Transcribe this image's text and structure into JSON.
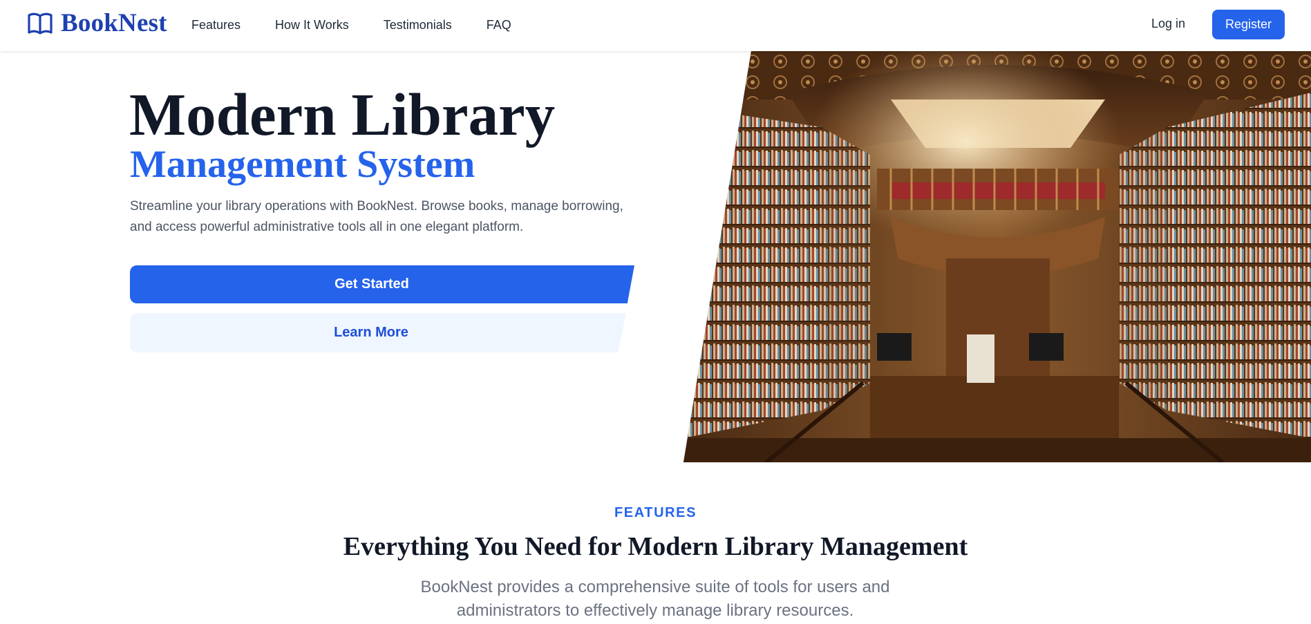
{
  "header": {
    "brand": "BookNest",
    "nav": [
      {
        "label": "Features"
      },
      {
        "label": "How It Works"
      },
      {
        "label": "Testimonials"
      },
      {
        "label": "FAQ"
      }
    ],
    "login_label": "Log in",
    "register_label": "Register"
  },
  "hero": {
    "title": "Modern Library",
    "subtitle": "Management System",
    "description": "Streamline your library operations with BookNest. Browse books, manage borrowing, and access powerful administrative tools all in one elegant platform.",
    "primary_cta": "Get Started",
    "secondary_cta": "Learn More"
  },
  "features": {
    "eyebrow": "FEATURES",
    "title": "Everything You Need for Modern Library Management",
    "description": "BookNest provides a comprehensive suite of tools for users and administrators to effectively manage library resources."
  },
  "colors": {
    "brand": "#1e40af",
    "primary": "#2563eb",
    "primary_soft": "#eff6ff",
    "text": "#111827",
    "muted": "#4b5563"
  }
}
